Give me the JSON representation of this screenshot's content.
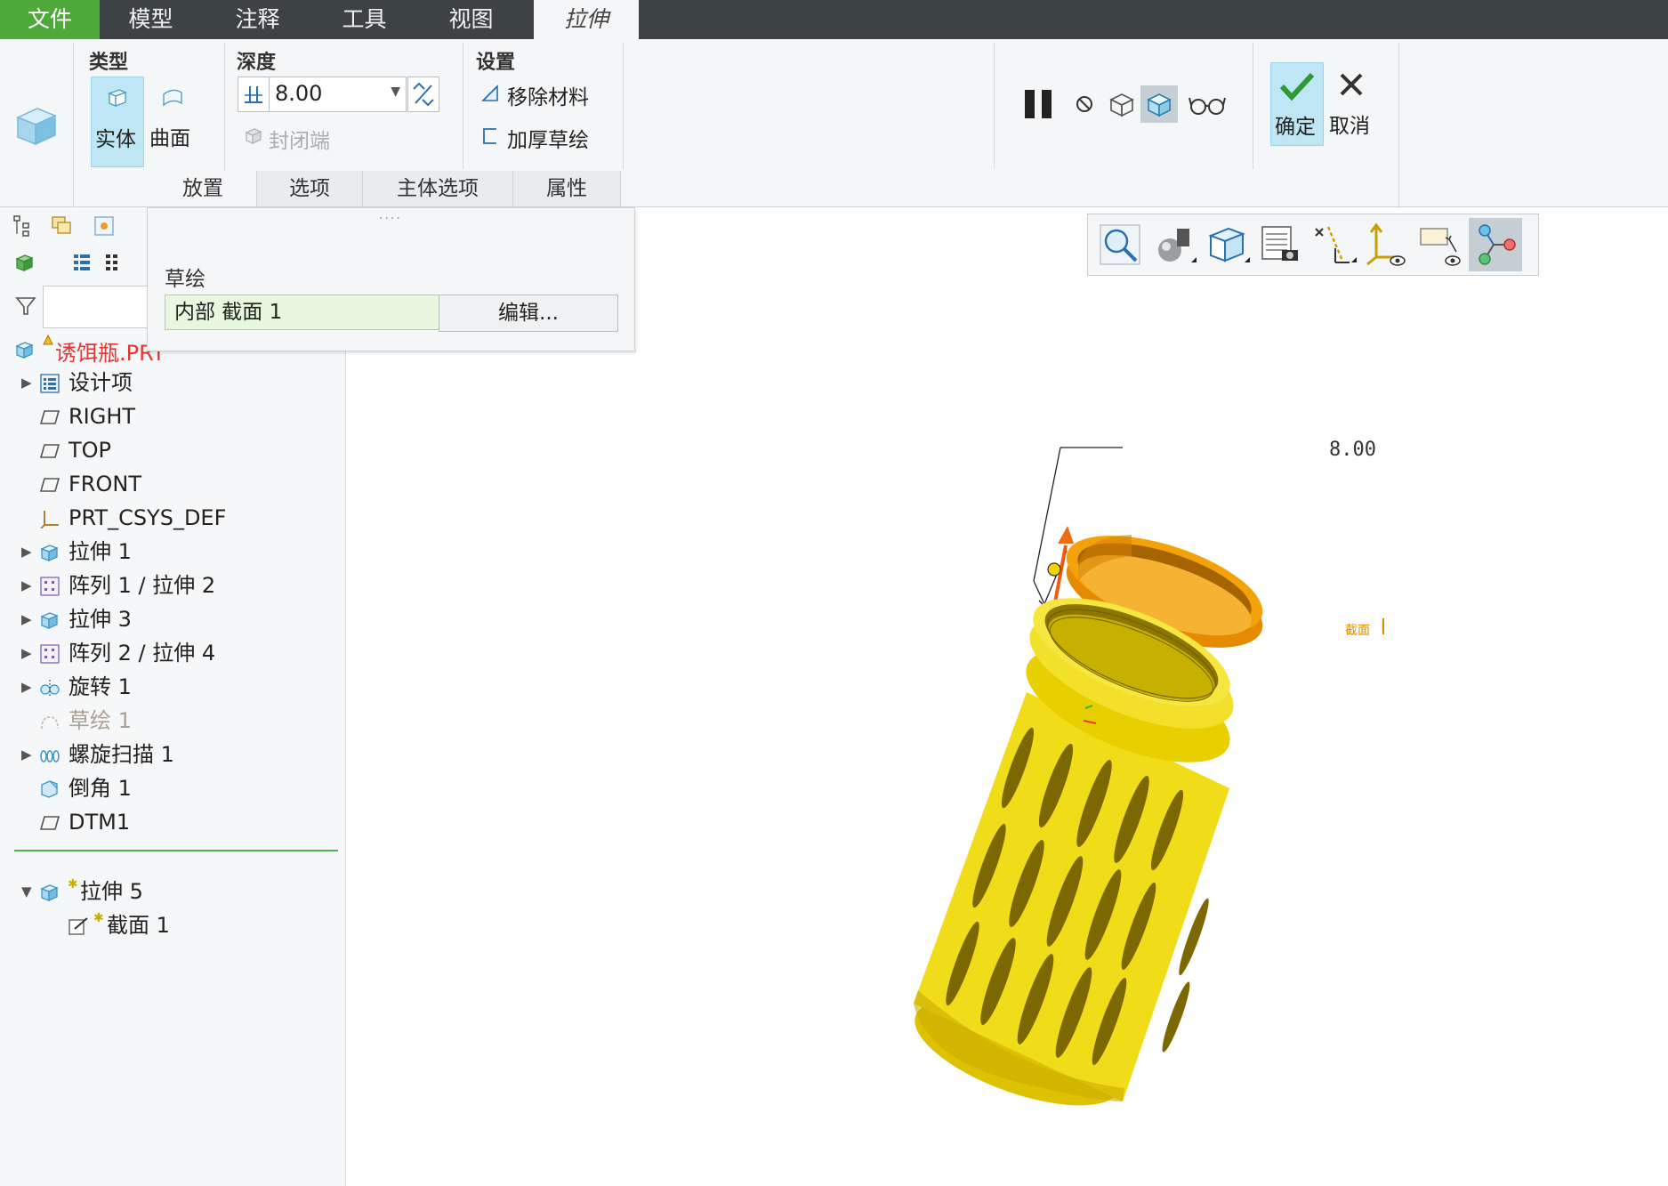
{
  "menubar": {
    "tabs": [
      {
        "label": "文件"
      },
      {
        "label": "模型"
      },
      {
        "label": "注释"
      },
      {
        "label": "工具"
      },
      {
        "label": "视图"
      },
      {
        "label": "拉伸"
      }
    ]
  },
  "ribbon": {
    "type_group": {
      "label": "类型",
      "solid": "实体",
      "surface": "曲面"
    },
    "depth_group": {
      "label": "深度",
      "value": "8.00",
      "capped_ends": "封闭端"
    },
    "settings_group": {
      "label": "设置",
      "remove_material": "移除材料",
      "thicken_sketch": "加厚草绘"
    },
    "actions": {
      "ok": "确定",
      "cancel": "取消"
    },
    "subtabs": [
      {
        "label": "放置"
      },
      {
        "label": "选项"
      },
      {
        "label": "主体选项"
      },
      {
        "label": "属性"
      }
    ]
  },
  "placement_panel": {
    "sketch_label": "草绘",
    "sketch_value": "内部 截面 1",
    "edit_button": "编辑..."
  },
  "model_tree": {
    "root": "诱饵瓶.PRT",
    "items": [
      {
        "label": "设计项",
        "icon": "design-items-icon"
      },
      {
        "label": "RIGHT",
        "icon": "datum-plane-icon"
      },
      {
        "label": "TOP",
        "icon": "datum-plane-icon"
      },
      {
        "label": "FRONT",
        "icon": "datum-plane-icon"
      },
      {
        "label": "PRT_CSYS_DEF",
        "icon": "csys-icon"
      },
      {
        "label": "拉伸 1",
        "icon": "extrude-icon"
      },
      {
        "label": "阵列 1 / 拉伸 2",
        "icon": "pattern-icon"
      },
      {
        "label": "拉伸 3",
        "icon": "extrude-icon"
      },
      {
        "label": "阵列 2 / 拉伸 4",
        "icon": "pattern-icon"
      },
      {
        "label": "旋转 1",
        "icon": "revolve-icon"
      },
      {
        "label": "草绘 1",
        "icon": "sketch-icon"
      },
      {
        "label": "螺旋扫描 1",
        "icon": "helical-sweep-icon"
      },
      {
        "label": "倒角 1",
        "icon": "chamfer-icon"
      },
      {
        "label": "DTM1",
        "icon": "datum-plane-icon"
      }
    ],
    "active_feature": "拉伸 5",
    "active_child": "截面 1"
  },
  "viewport": {
    "dimension": "8.00",
    "section_tag": "截面"
  },
  "colors": {
    "file_tab": "#4fa83a",
    "menubar": "#3d4245",
    "model_yellow": "#f1dc1a",
    "ring_orange": "#f4a20a",
    "selection_blue": "#bfe6f4",
    "root_red": "#e53333"
  }
}
